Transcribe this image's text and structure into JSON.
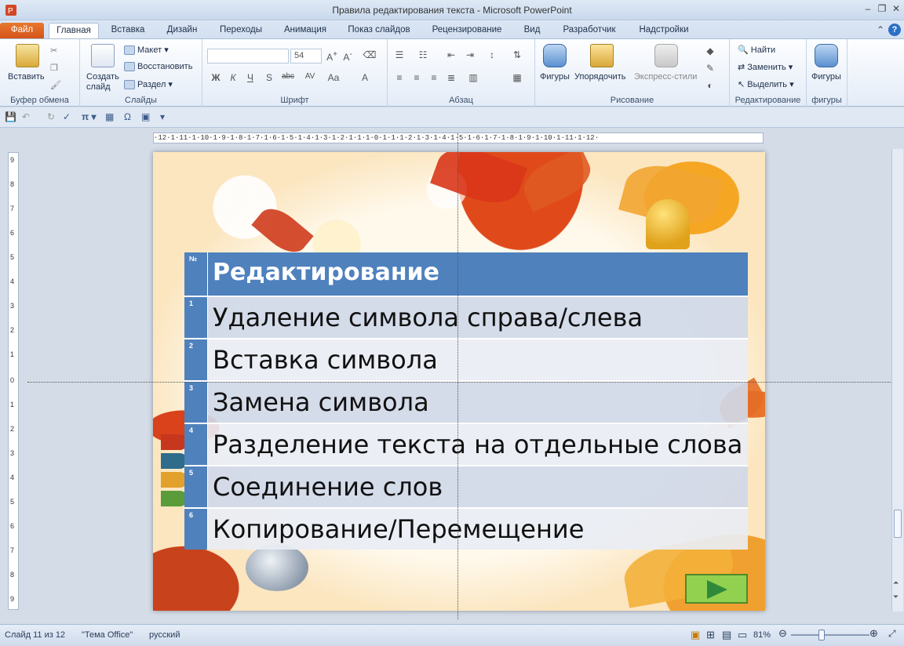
{
  "window": {
    "title": "Правила редактирования текста  -  Microsoft PowerPoint"
  },
  "tabs": [
    "Файл",
    "Главная",
    "Вставка",
    "Дизайн",
    "Переходы",
    "Анимация",
    "Показ слайдов",
    "Рецензирование",
    "Вид",
    "Разработчик",
    "Надстройки"
  ],
  "ribbon": {
    "clipboard": {
      "label": "Буфер обмена",
      "paste": "Вставить"
    },
    "slides": {
      "label": "Слайды",
      "new_slide": "Создать слайд",
      "layout": "Макет",
      "reset": "Восстановить",
      "section": "Раздел"
    },
    "font": {
      "label": "Шрифт",
      "font_name": "",
      "font_size": "54"
    },
    "paragraph": {
      "label": "Абзац"
    },
    "drawing": {
      "label": "Рисование",
      "shapes": "Фигуры",
      "arrange": "Упорядочить",
      "quick_styles": "Экспресс-стили"
    },
    "editing": {
      "label": "Редактирование",
      "find": "Найти",
      "replace": "Заменить",
      "select": "Выделить"
    },
    "figures": {
      "label": "фигуры",
      "shapes": "Фигуры"
    }
  },
  "ruler": {
    "horizontal": "·12·1·11·1·10·1·9·1·8·1·7·1·6·1·5·1·4·1·3·1·2·1·1·1·0·1·1·1·2·1·3·1·4·1·5·1·6·1·7·1·8·1·9·1·10·1·11·1·12·",
    "vertical": [
      "9",
      "8",
      "7",
      "6",
      "5",
      "4",
      "3",
      "2",
      "1",
      "0",
      "1",
      "2",
      "3",
      "4",
      "5",
      "6",
      "7",
      "8",
      "9"
    ]
  },
  "slide": {
    "table": {
      "header_num": "№",
      "header_title": "Редактирование",
      "rows": [
        {
          "num": "1",
          "text": "Удаление символа справа/слева"
        },
        {
          "num": "2",
          "text": "Вставка символа"
        },
        {
          "num": "3",
          "text": "Замена  символа"
        },
        {
          "num": "4",
          "text": "Разделение текста на отдельные слова"
        },
        {
          "num": "5",
          "text": "Соединение слов"
        },
        {
          "num": "6",
          "text": "Копирование/Перемещение"
        }
      ]
    }
  },
  "status": {
    "slide_info": "Слайд 11 из 12",
    "theme": "\"Тема Office\"",
    "language": "русский",
    "zoom": "81%"
  },
  "colors": {
    "table_header": "#4f81bd",
    "row_odd": "#d0d8e8",
    "row_even": "#e9edf4",
    "file_tab": "#e06a24",
    "next_button": "#92d050"
  }
}
